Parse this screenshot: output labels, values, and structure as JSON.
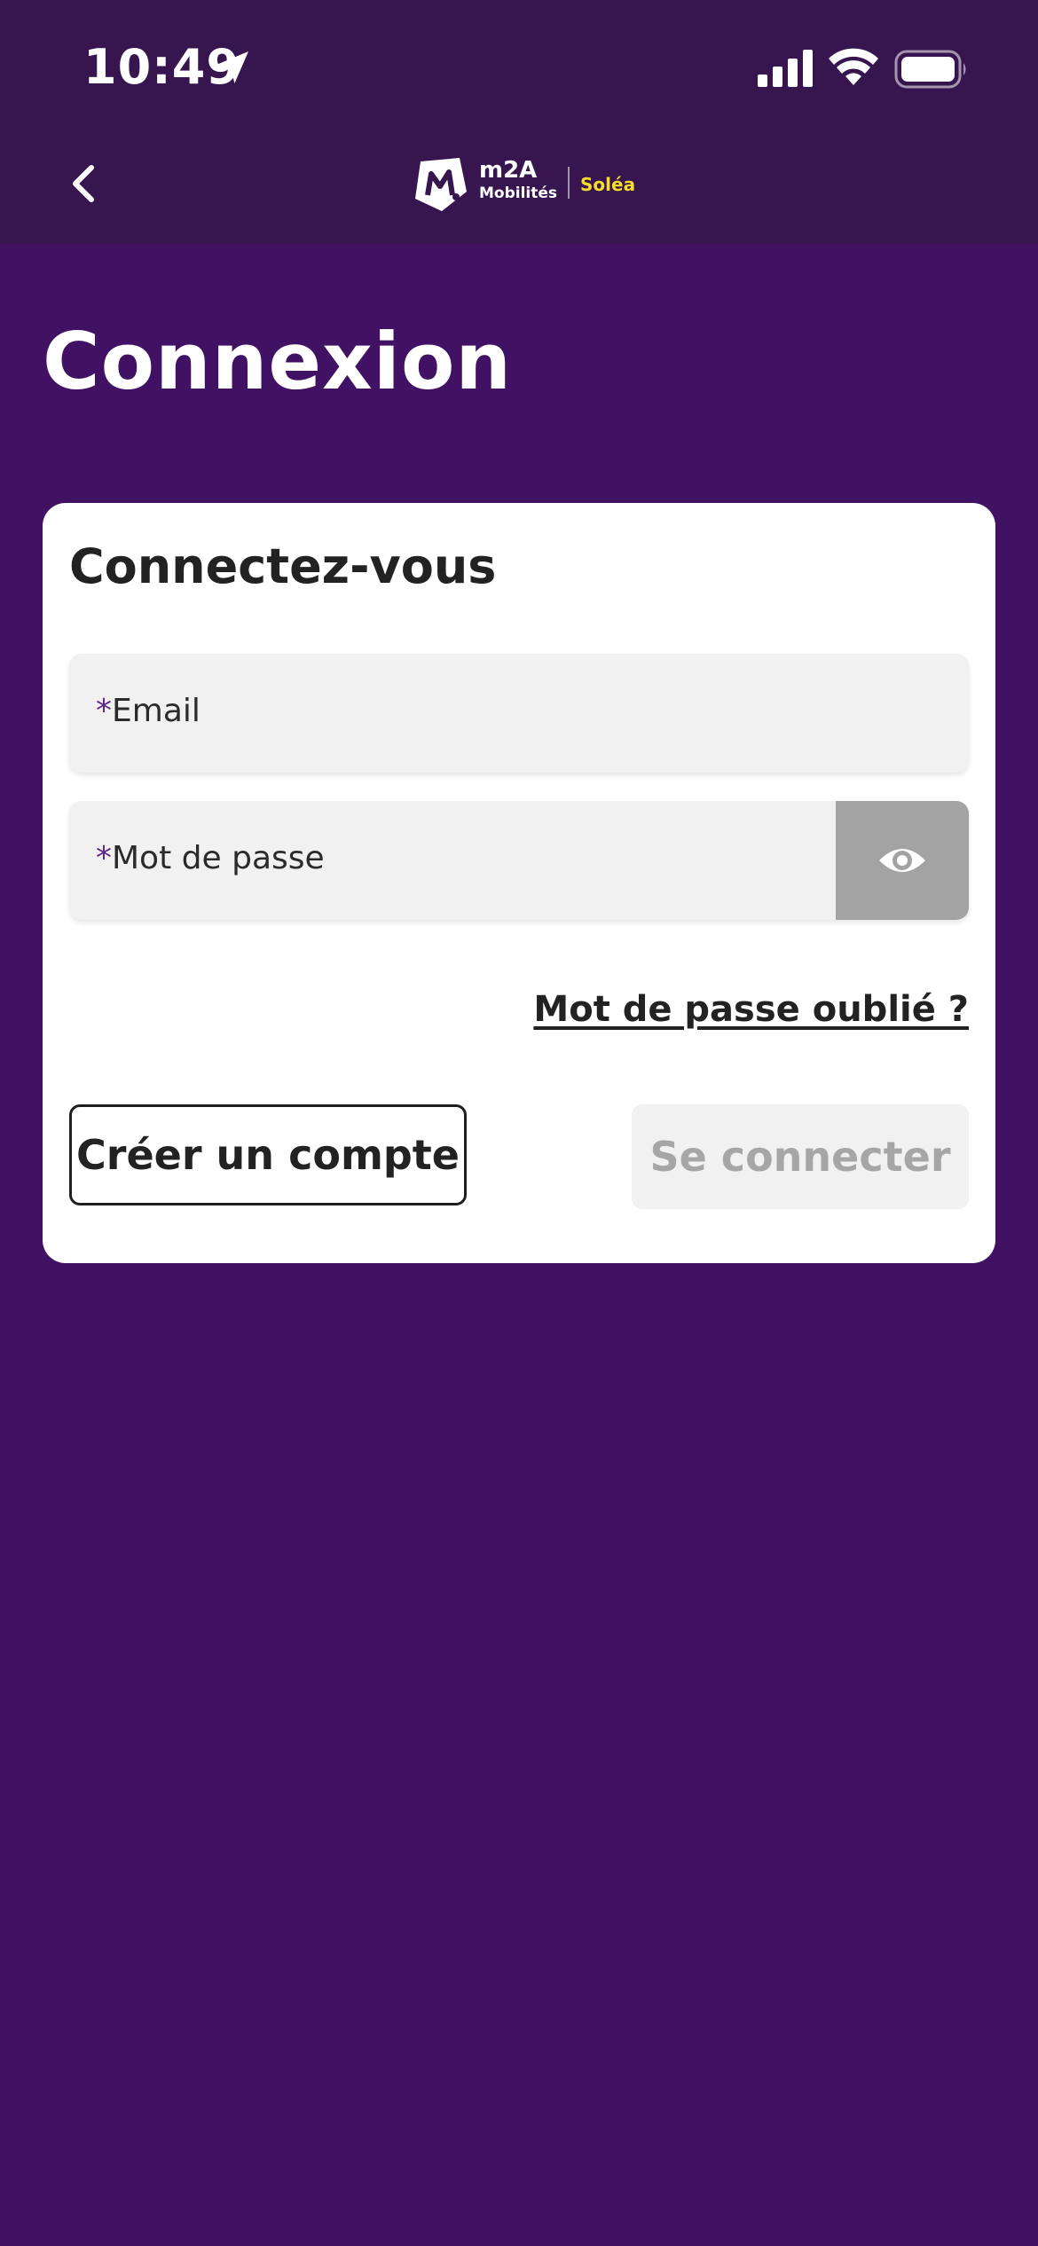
{
  "status_bar": {
    "time": "10:49",
    "icons": [
      "location-arrow-icon",
      "signal-icon",
      "wifi-icon",
      "battery-icon"
    ]
  },
  "nav": {
    "back_icon": "chevron-left-icon",
    "logo": {
      "brand": "m2A",
      "subtitle": "Mobilités",
      "partner": "Soléa"
    }
  },
  "page": {
    "title": "Connexion"
  },
  "form": {
    "title": "Connectez-vous",
    "email": {
      "required_mark": "*",
      "label": "Email",
      "value": ""
    },
    "password": {
      "required_mark": "*",
      "label": "Mot de passe",
      "value": "",
      "toggle_icon": "eye-icon"
    },
    "forgot_password": "Mot de passe oublié ?",
    "create_account": "Créer un compte",
    "login": "Se connecter"
  },
  "colors": {
    "background": "#411263",
    "header": "#37154f",
    "card": "#ffffff",
    "field": "#f1f1f1",
    "toggle": "#a3a3a3",
    "accent_yellow": "#f5dd2b"
  }
}
